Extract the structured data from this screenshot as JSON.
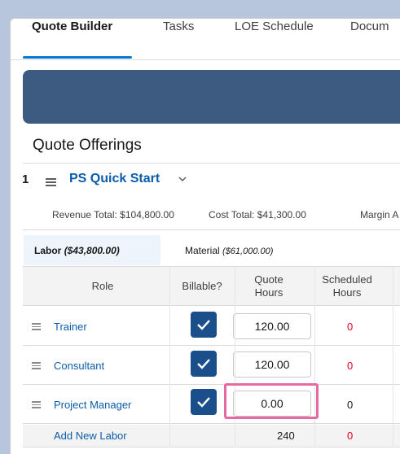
{
  "tabs": [
    {
      "label": "Quote Builder",
      "active": true
    },
    {
      "label": "Tasks",
      "active": false
    },
    {
      "label": "LOE Schedule",
      "active": false
    },
    {
      "label": "Docum",
      "active": false
    }
  ],
  "section_title": "Quote Offerings",
  "offering": {
    "number": "1",
    "name": "PS Quick Start",
    "revenue_total": "Revenue Total: $104,800.00",
    "cost_total": "Cost Total: $41,300.00",
    "margin": "Margin A"
  },
  "subtabs": {
    "labor_label": "Labor",
    "labor_amount": "($43,800.00)",
    "material_label": "Material",
    "material_amount": "($61,000.00)"
  },
  "table": {
    "headers": {
      "role": "Role",
      "billable": "Billable?",
      "quote_hours_1": "Quote",
      "quote_hours_2": "Hours",
      "scheduled_1": "Scheduled",
      "scheduled_2": "Hours"
    },
    "rows": [
      {
        "role": "Trainer",
        "billable": true,
        "quote_hours": "120.00",
        "scheduled": "0"
      },
      {
        "role": "Consultant",
        "billable": true,
        "quote_hours": "120.00",
        "scheduled": "0"
      },
      {
        "role": "Project Manager",
        "billable": true,
        "quote_hours": "0.00",
        "scheduled": "0"
      }
    ],
    "footer": {
      "add_label": "Add New Labor",
      "total_quote": "240",
      "total_scheduled": "0"
    }
  },
  "colors": {
    "accent": "#0176d3",
    "banner": "#3d5a80",
    "checkbox": "#1b4f8c",
    "negative": "#ea001e",
    "highlight": "#e66aa0"
  },
  "icons": [
    "drag-handle-icon",
    "chevron-down-icon",
    "checkmark-icon"
  ]
}
